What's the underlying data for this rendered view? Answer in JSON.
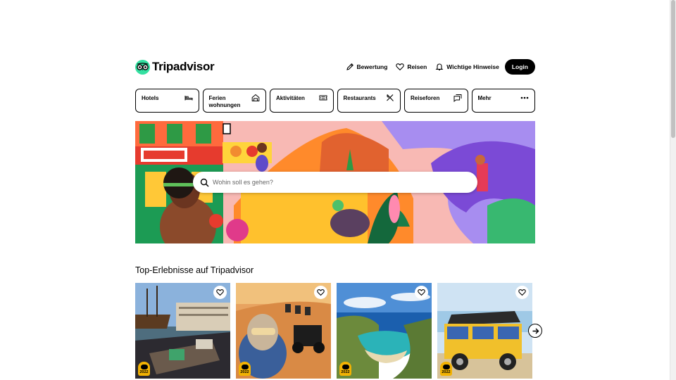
{
  "brand": {
    "name": "Tripadvisor",
    "accent": "#34e0a1"
  },
  "nav": {
    "review": {
      "label": "Bewertung",
      "icon": "pencil-icon"
    },
    "trips": {
      "label": "Reisen",
      "icon": "heart-icon"
    },
    "alerts": {
      "label": "Wichtige Hinweise",
      "icon": "bell-icon"
    },
    "login": {
      "label": "Login"
    }
  },
  "categories": [
    {
      "label": "Hotels",
      "icon": "bed-icon"
    },
    {
      "label": "Ferien\nwohnungen",
      "icon": "house-icon"
    },
    {
      "label": "Aktivitäten",
      "icon": "ticket-icon"
    },
    {
      "label": "Restaurants",
      "icon": "cutlery-icon"
    },
    {
      "label": "Reiseforen",
      "icon": "chat-icon"
    },
    {
      "label": "Mehr",
      "icon": "more-icon"
    }
  ],
  "search": {
    "placeholder": "Wohin soll es gehen?"
  },
  "section": {
    "title": "Top-Erlebnisse auf Tripadvisor"
  },
  "cards": [
    {
      "name": "amsterdam-boat-tour",
      "badge_year": "2022"
    },
    {
      "name": "desert-quad-tour",
      "badge_year": "2022"
    },
    {
      "name": "hanauma-bay",
      "badge_year": "2022"
    },
    {
      "name": "jeep-island-tour",
      "badge_year": "2022"
    }
  ]
}
